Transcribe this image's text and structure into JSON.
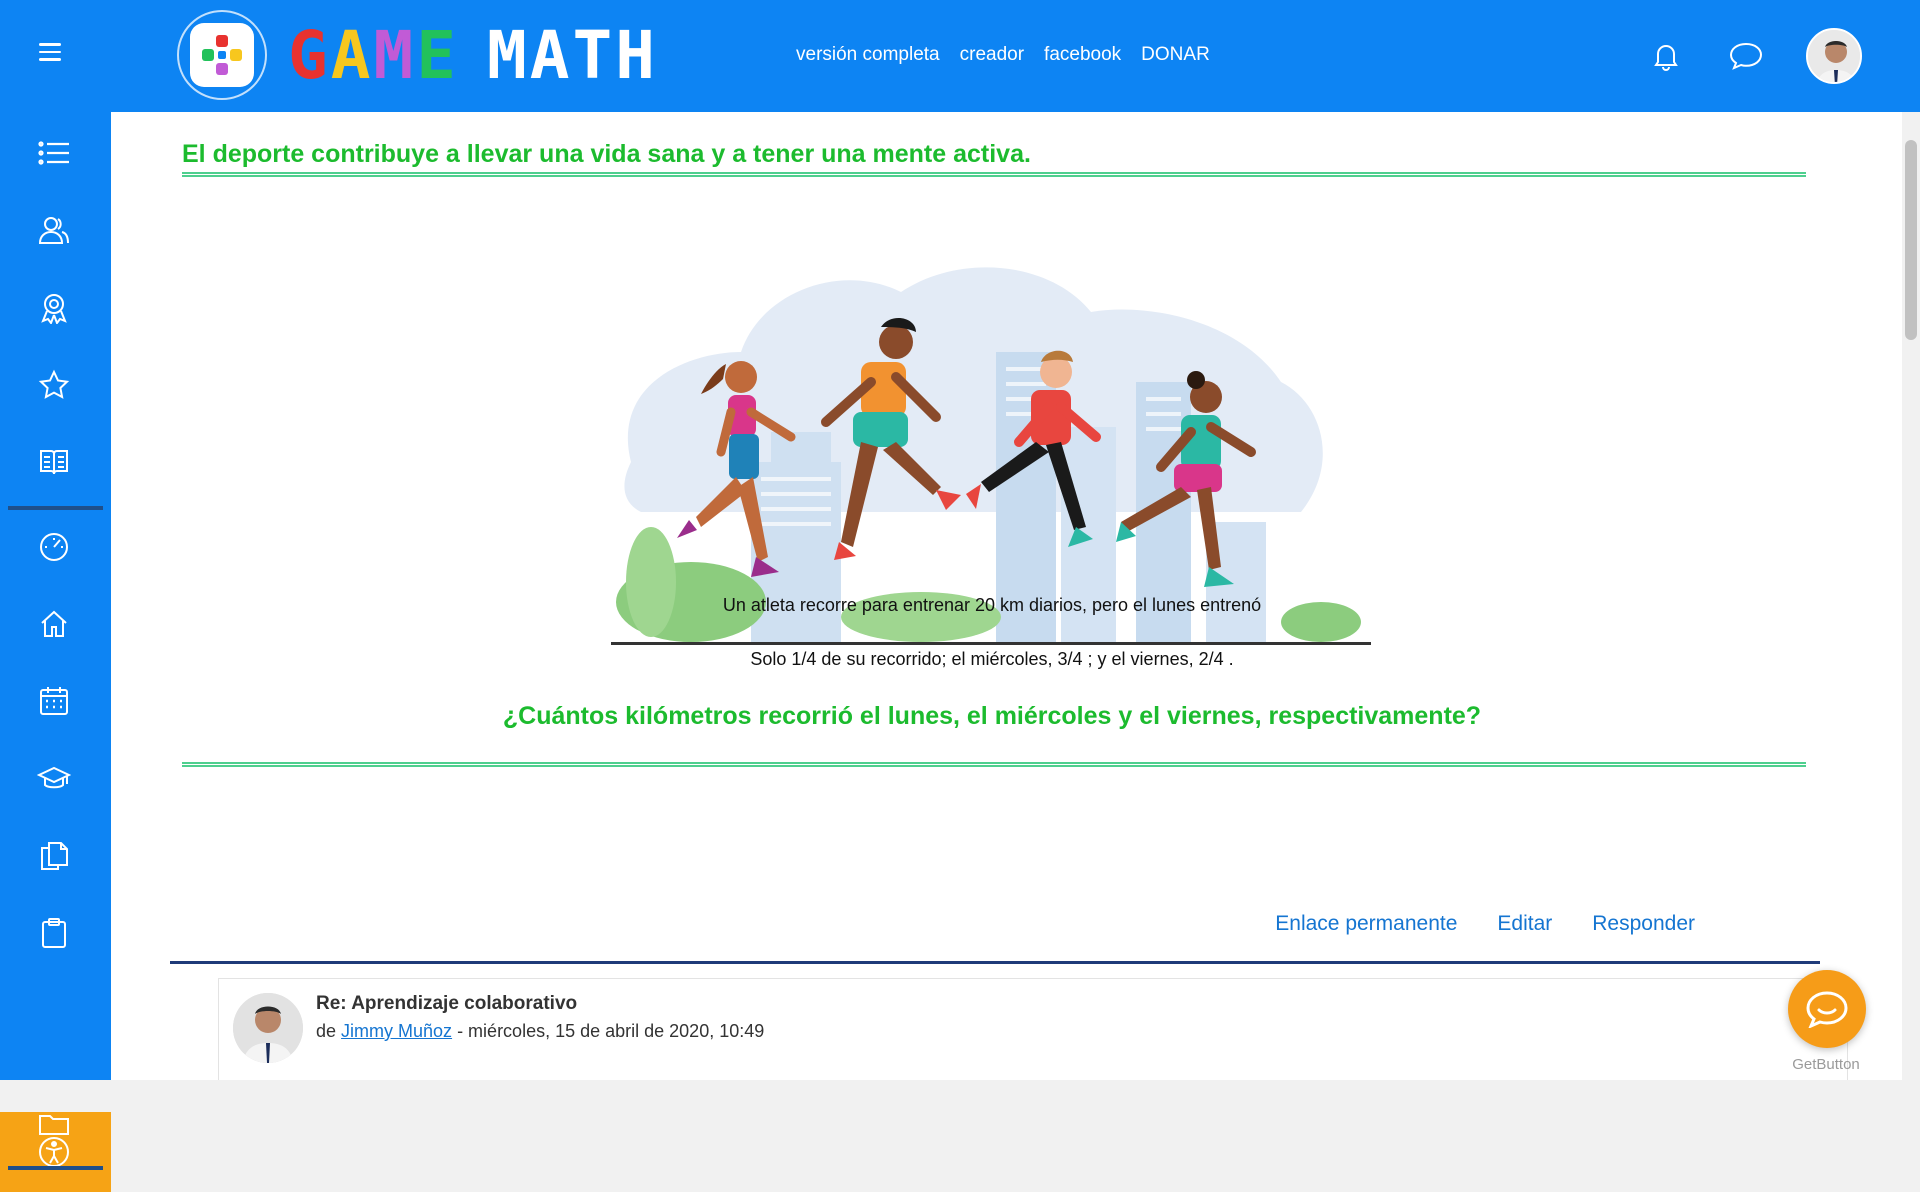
{
  "header": {
    "logo_text_game": "GAME",
    "logo_text_math": "MATH",
    "nav": [
      {
        "label": "versión completa"
      },
      {
        "label": "creador"
      },
      {
        "label": "facebook"
      },
      {
        "label": "DONAR"
      }
    ],
    "icons": [
      "menu-icon",
      "bell-icon",
      "chat-icon",
      "user-avatar"
    ]
  },
  "sidebar": {
    "items": [
      {
        "icon": "list-icon"
      },
      {
        "icon": "users-icon"
      },
      {
        "icon": "award-icon"
      },
      {
        "icon": "star-icon"
      },
      {
        "icon": "book-icon"
      },
      {
        "icon": "dashboard-icon"
      },
      {
        "icon": "home-icon"
      },
      {
        "icon": "calendar-icon"
      },
      {
        "icon": "graduation-cap-icon"
      },
      {
        "icon": "files-icon"
      },
      {
        "icon": "clipboard-icon"
      },
      {
        "icon": "folder-icon"
      },
      {
        "icon": "accessibility-icon"
      }
    ]
  },
  "content": {
    "heading": "El deporte contribuye a llevar una vida sana y a tener una mente activa.",
    "paragraph_1": "Un atleta recorre para entrenar 20 km diarios, pero el lunes entrenó",
    "paragraph_2": "Solo 1/4  de su recorrido; el miércoles, 3/4  ; y el viernes,  2/4 .",
    "question": "¿Cuántos kilómetros recorrió el lunes, el miércoles y el viernes, respectivamente?",
    "illustration": "four-runners-illustration"
  },
  "actions": {
    "permalink": "Enlace permanente",
    "edit": "Editar",
    "reply": "Responder"
  },
  "reply": {
    "title": "Re: Aprendizaje colaborativo",
    "by_prefix": "de",
    "author": "Jimmy Muñoz",
    "date": " - miércoles, 15 de abril de 2020, 10:49"
  },
  "chat_widget": {
    "label": "GetButton"
  },
  "colors": {
    "brand_blue": "#0d84f3",
    "heading_green": "#1cbb2e",
    "link_blue": "#1575d1",
    "accent_orange": "#f69c18"
  }
}
